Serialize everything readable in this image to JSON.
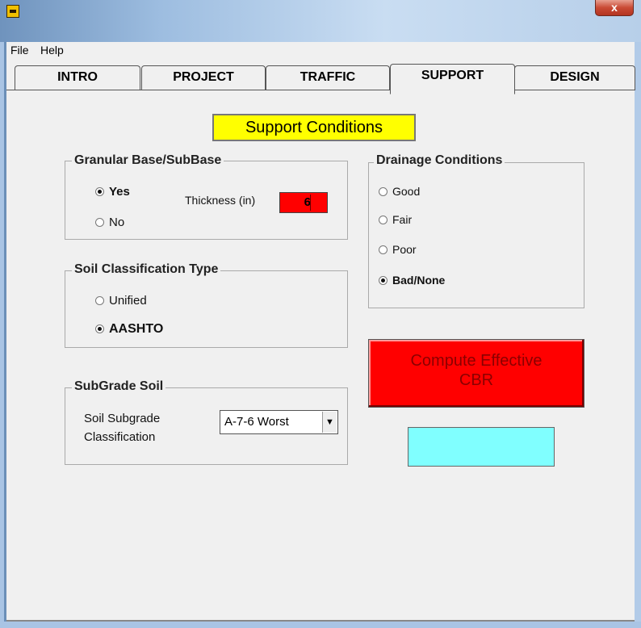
{
  "window": {
    "close_label": "x"
  },
  "menu": [
    {
      "label": "File"
    },
    {
      "label": "Help"
    }
  ],
  "tabs": [
    {
      "label": "INTRO"
    },
    {
      "label": "PROJECT"
    },
    {
      "label": "TRAFFIC"
    },
    {
      "label": "SUPPORT",
      "active": true
    },
    {
      "label": "DESIGN"
    }
  ],
  "heading": "Support Conditions",
  "granular": {
    "title": "Granular Base/SubBase",
    "options": [
      {
        "label": "Yes",
        "selected": true
      },
      {
        "label": "No",
        "selected": false
      }
    ],
    "thickness_label": "Thickness (in)",
    "thickness_value": "6"
  },
  "soil_class": {
    "title": "Soil Classification Type",
    "options": [
      {
        "label": "Unified",
        "selected": false
      },
      {
        "label": "AASHTO",
        "selected": true
      }
    ]
  },
  "subgrade": {
    "title": "SubGrade Soil",
    "label_line1": "Soil Subgrade",
    "label_line2": "Classification",
    "selected": "A-7-6 Worst"
  },
  "drainage": {
    "title": "Drainage Conditions",
    "options": [
      {
        "label": "Good",
        "selected": false
      },
      {
        "label": "Fair",
        "selected": false
      },
      {
        "label": "Poor",
        "selected": false
      },
      {
        "label": "Bad/None",
        "selected": true
      }
    ]
  },
  "compute": {
    "line1": "Compute Effective",
    "line2": "CBR"
  },
  "cbr_output": "",
  "colors": {
    "heading_bg": "#ffff00",
    "input_bg": "#ff0000",
    "button_bg": "#ff0000",
    "output_bg": "#80ffff"
  }
}
